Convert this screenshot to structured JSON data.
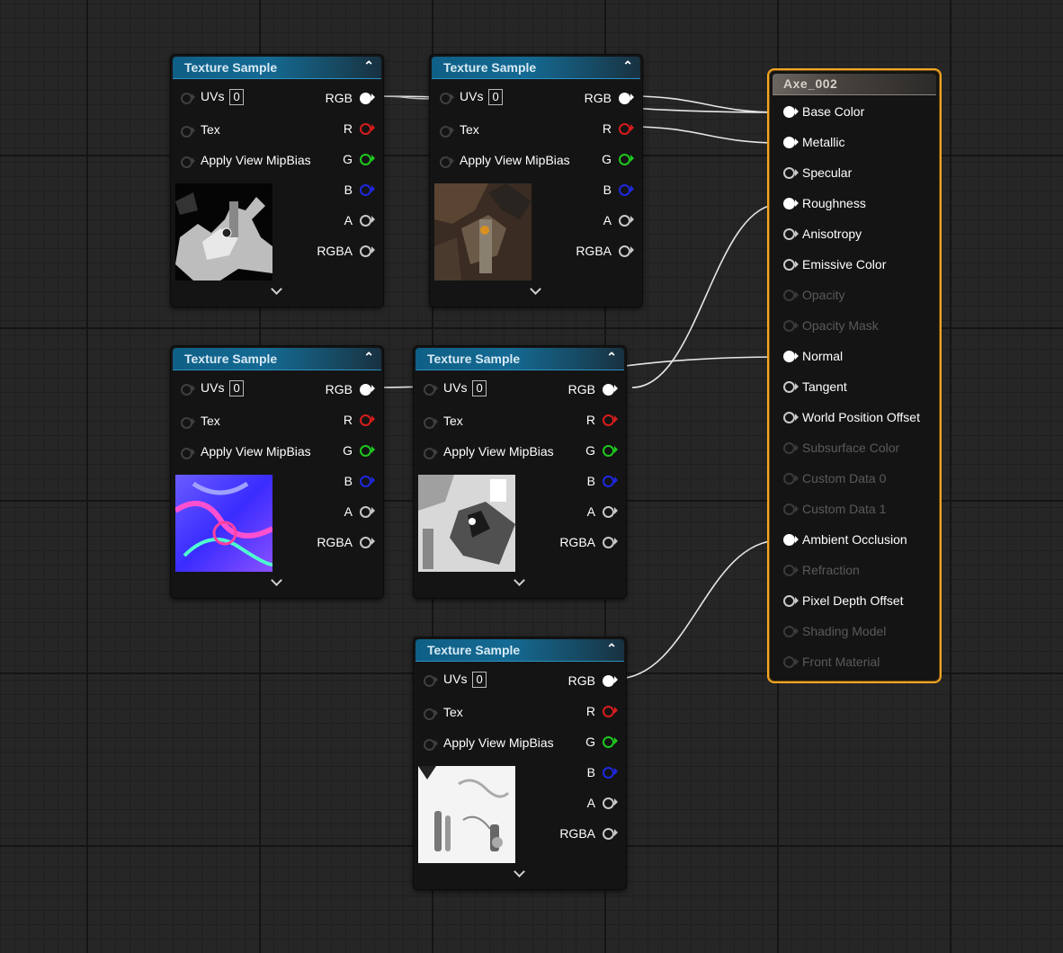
{
  "texture_nodes": [
    {
      "title": "Texture Sample",
      "uvs_label": "UVs",
      "uvs_value": "0",
      "tex_label": "Tex",
      "mipbias_label": "Apply View MipBias",
      "outputs": [
        "RGB",
        "R",
        "G",
        "B",
        "A",
        "RGBA"
      ],
      "thumbnail": "grayscale-metallic-map"
    },
    {
      "title": "Texture Sample",
      "uvs_label": "UVs",
      "uvs_value": "0",
      "tex_label": "Tex",
      "mipbias_label": "Apply View MipBias",
      "outputs": [
        "RGB",
        "R",
        "G",
        "B",
        "A",
        "RGBA"
      ],
      "thumbnail": "base-color-map"
    },
    {
      "title": "Texture Sample",
      "uvs_label": "UVs",
      "uvs_value": "0",
      "tex_label": "Tex",
      "mipbias_label": "Apply View MipBias",
      "outputs": [
        "RGB",
        "R",
        "G",
        "B",
        "A",
        "RGBA"
      ],
      "thumbnail": "normal-map"
    },
    {
      "title": "Texture Sample",
      "uvs_label": "UVs",
      "uvs_value": "0",
      "tex_label": "Tex",
      "mipbias_label": "Apply View MipBias",
      "outputs": [
        "RGB",
        "R",
        "G",
        "B",
        "A",
        "RGBA"
      ],
      "thumbnail": "roughness-map"
    },
    {
      "title": "Texture Sample",
      "uvs_label": "UVs",
      "uvs_value": "0",
      "tex_label": "Tex",
      "mipbias_label": "Apply View MipBias",
      "outputs": [
        "RGB",
        "R",
        "G",
        "B",
        "A",
        "RGBA"
      ],
      "thumbnail": "ambient-occlusion-map"
    }
  ],
  "material": {
    "title": "Axe_002",
    "inputs": [
      {
        "label": "Base Color",
        "state": "connected"
      },
      {
        "label": "Metallic",
        "state": "connected"
      },
      {
        "label": "Specular",
        "state": "active"
      },
      {
        "label": "Roughness",
        "state": "connected"
      },
      {
        "label": "Anisotropy",
        "state": "active"
      },
      {
        "label": "Emissive Color",
        "state": "active"
      },
      {
        "label": "Opacity",
        "state": "disabled"
      },
      {
        "label": "Opacity Mask",
        "state": "disabled"
      },
      {
        "label": "Normal",
        "state": "connected"
      },
      {
        "label": "Tangent",
        "state": "active"
      },
      {
        "label": "World Position Offset",
        "state": "active"
      },
      {
        "label": "Subsurface Color",
        "state": "disabled"
      },
      {
        "label": "Custom Data 0",
        "state": "disabled"
      },
      {
        "label": "Custom Data 1",
        "state": "disabled"
      },
      {
        "label": "Ambient Occlusion",
        "state": "connected"
      },
      {
        "label": "Refraction",
        "state": "disabled"
      },
      {
        "label": "Pixel Depth Offset",
        "state": "active"
      },
      {
        "label": "Shading Model",
        "state": "disabled"
      },
      {
        "label": "Front Material",
        "state": "disabled"
      }
    ]
  },
  "colors": {
    "header_blue": "#146a93",
    "material_border": "#f5a623",
    "pin_r": "#d81c1c",
    "pin_g": "#1ec81e",
    "pin_b": "#1e28e0",
    "pin_white": "#ffffff",
    "disabled_text": "#5a5a5a"
  },
  "icons": {
    "collapse": "chevron-up-icon",
    "expand": "chevron-down-icon",
    "pin": "pin-circle-icon"
  }
}
